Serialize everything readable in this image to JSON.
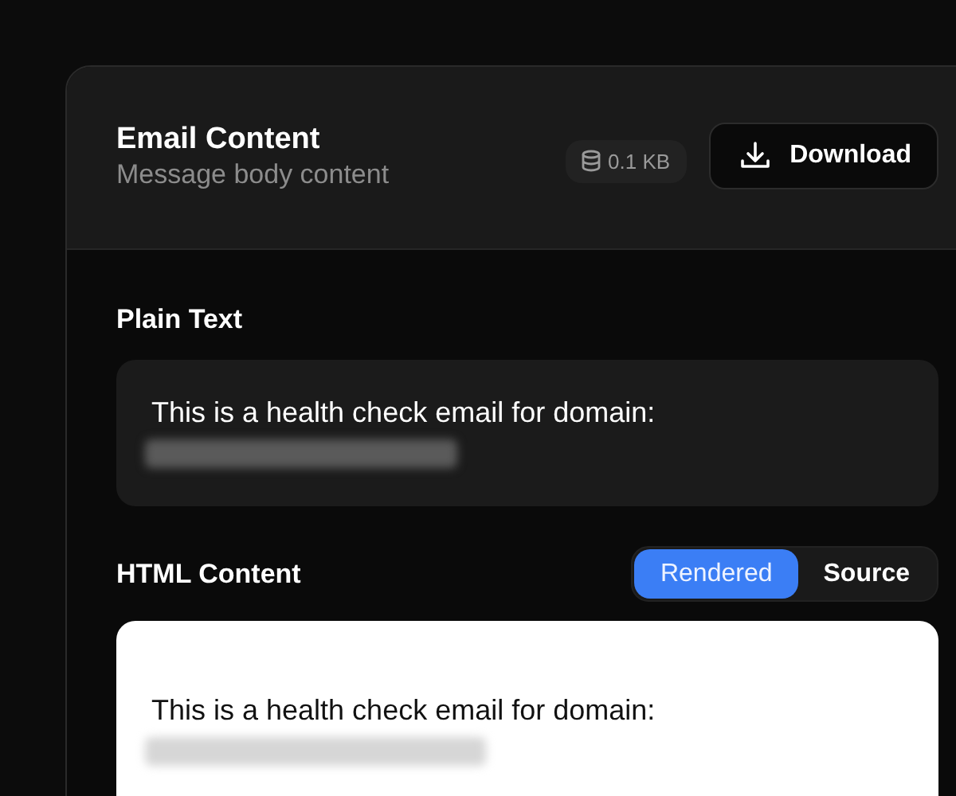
{
  "header": {
    "title": "Email Content",
    "subtitle": "Message body content",
    "size_badge": "0.1 KB",
    "download_button": "Download"
  },
  "plain_text": {
    "label": "Plain Text",
    "text": "This is a health check email for domain:",
    "domain_redacted": true
  },
  "html_content": {
    "label": "HTML Content",
    "view_tabs": [
      {
        "label": "Rendered",
        "selected": true
      },
      {
        "label": "Source",
        "selected": false
      }
    ],
    "text": "This is a health check email for domain:",
    "domain_redacted": true
  }
}
